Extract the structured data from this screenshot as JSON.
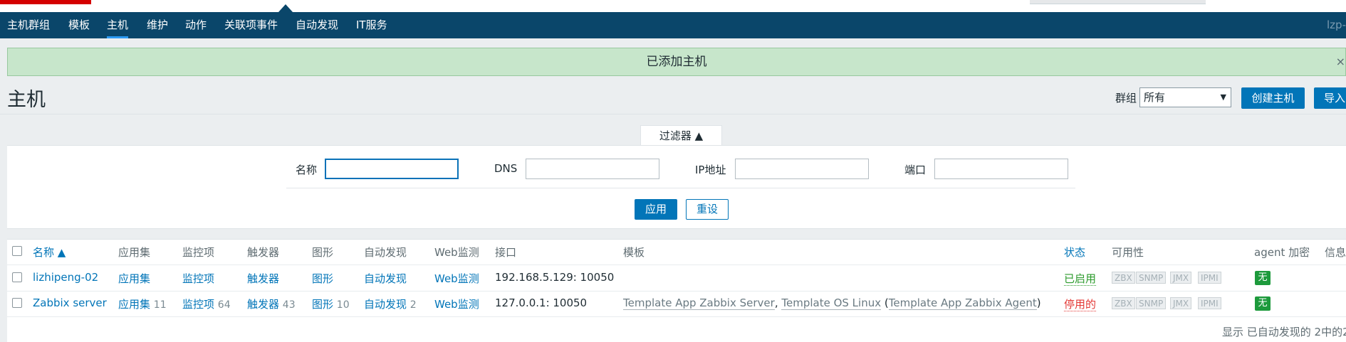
{
  "nav": {
    "items": [
      "主机群组",
      "模板",
      "主机",
      "维护",
      "动作",
      "关联项事件",
      "自动发现",
      "IT服务"
    ],
    "active": "主机",
    "user": "lzp-"
  },
  "message": {
    "text": "已添加主机",
    "close": "×"
  },
  "page": {
    "title": "主机"
  },
  "controls": {
    "group_label": "群组",
    "group_value": "所有",
    "create_button": "创建主机",
    "import_button": "导入"
  },
  "filter": {
    "tab_label": "过滤器 ▲",
    "name_label": "名称",
    "dns_label": "DNS",
    "ip_label": "IP地址",
    "port_label": "端口",
    "name_value": "",
    "dns_value": "",
    "ip_value": "",
    "port_value": "",
    "apply": "应用",
    "reset": "重设"
  },
  "table": {
    "headers": {
      "name": "名称 ▲",
      "apps": "应用集",
      "items": "监控项",
      "triggers": "触发器",
      "graphs": "图形",
      "discovery": "自动发现",
      "web": "Web监测",
      "interface": "接口",
      "templates": "模板",
      "status": "状态",
      "availability": "可用性",
      "agent_enc": "agent 加密",
      "info": "信息"
    },
    "availability_labels": [
      "ZBX",
      "SNMP",
      "JMX",
      "IPMI"
    ],
    "rows": [
      {
        "name": "lizhipeng-02",
        "apps": "应用集",
        "apps_count": "",
        "items": "监控项",
        "items_count": "",
        "triggers": "触发器",
        "triggers_count": "",
        "graphs": "图形",
        "graphs_count": "",
        "discovery": "自动发现",
        "discovery_count": "",
        "web": "Web监测",
        "interface": "192.168.5.129: 10050",
        "templates": "",
        "status": "已启用",
        "encryption": "无"
      },
      {
        "name": "Zabbix server",
        "apps": "应用集",
        "apps_count": "11",
        "items": "监控项",
        "items_count": "64",
        "triggers": "触发器",
        "triggers_count": "43",
        "graphs": "图形",
        "graphs_count": "10",
        "discovery": "自动发现",
        "discovery_count": "2",
        "web": "Web监测",
        "interface": "127.0.0.1: 10050",
        "template_1": "Template App Zabbix Server",
        "template_sep": ",",
        "template_2": "Template OS Linux",
        "template_open": "(",
        "template_3": "Template App Zabbix Agent",
        "template_close": ")",
        "status": "停用的",
        "encryption": "无"
      }
    ]
  },
  "footer": {
    "text": "显示 已自动发现的 2中的2"
  }
}
